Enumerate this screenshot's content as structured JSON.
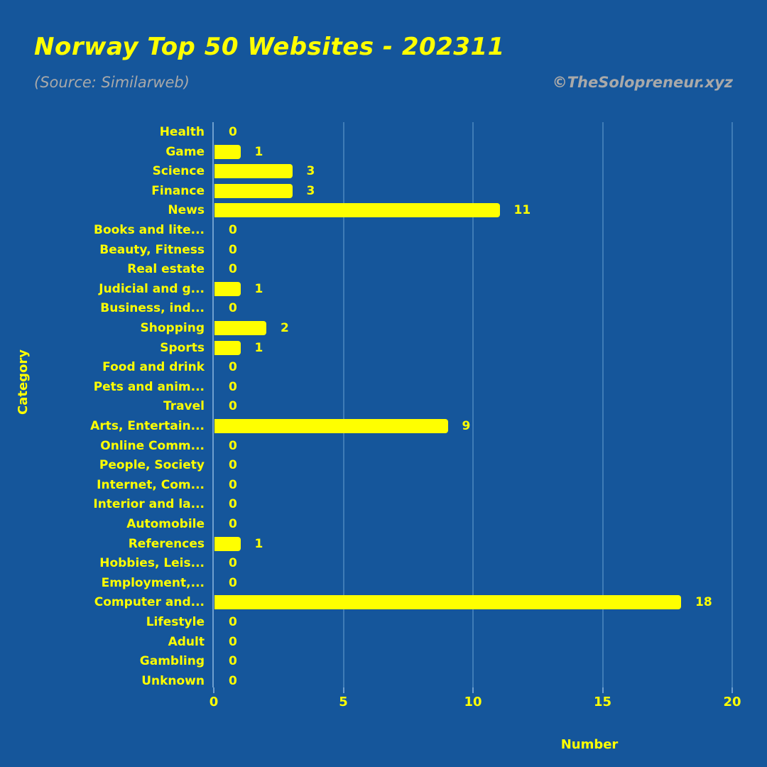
{
  "header": {
    "title": "Norway Top 50 Websites - 202311",
    "subtitle": "(Source: Similarweb)",
    "credit": "©TheSolopreneur.xyz"
  },
  "colors": {
    "background": "#15569B",
    "bar": "#FFFF00",
    "title": "#FFFF00",
    "subtitle": "#A9A9A9",
    "gridline": "#3F7CB6",
    "axis": "#6F9FCE"
  },
  "chart_data": {
    "type": "bar",
    "orientation": "horizontal",
    "title": "Norway Top 50 Websites - 202311",
    "subtitle": "(Source: Similarweb)",
    "xlabel": "Number",
    "ylabel": "Category",
    "xlim": [
      0,
      20
    ],
    "xticks": [
      0,
      5,
      10,
      15,
      20
    ],
    "xtick_labels": [
      "0",
      "5",
      "10",
      "15",
      "20"
    ],
    "grid": true,
    "legend": false,
    "categories": [
      "Health",
      "Game",
      "Science",
      "Finance",
      "News",
      "Books and lite...",
      "Beauty, Fitness",
      "Real estate",
      "Judicial and g...",
      "Business, ind...",
      "Shopping",
      "Sports",
      "Food and drink",
      "Pets and anim...",
      "Travel",
      "Arts, Entertain...",
      "Online Comm...",
      "People, Society",
      "Internet, Com...",
      "Interior and la...",
      "Automobile",
      "References",
      "Hobbies, Leis...",
      "Employment,...",
      "Computer and...",
      "Lifestyle",
      "Adult",
      "Gambling",
      "Unknown"
    ],
    "values": [
      0,
      1,
      3,
      3,
      11,
      0,
      0,
      0,
      1,
      0,
      2,
      1,
      0,
      0,
      0,
      9,
      0,
      0,
      0,
      0,
      0,
      1,
      0,
      0,
      18,
      0,
      0,
      0,
      0
    ],
    "value_labels": [
      "0",
      "1",
      "3",
      "3",
      "11",
      "0",
      "0",
      "0",
      "1",
      "0",
      "2",
      "1",
      "0",
      "0",
      "0",
      "9",
      "0",
      "0",
      "0",
      "0",
      "0",
      "1",
      "0",
      "0",
      "18",
      "0",
      "0",
      "0",
      "0"
    ]
  }
}
